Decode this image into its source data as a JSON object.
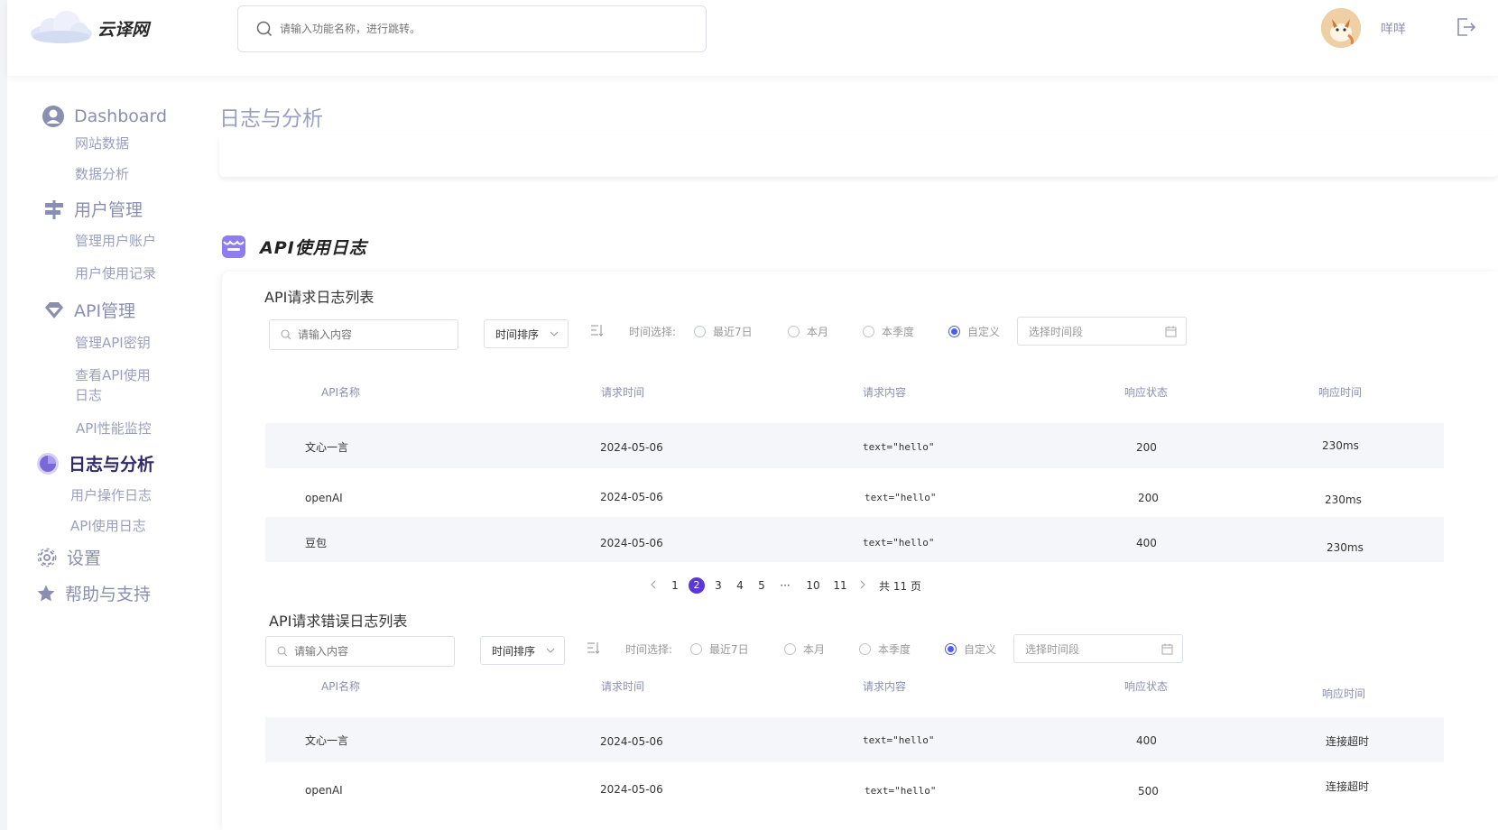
{
  "header": {
    "logo_text": "云译网",
    "search_placeholder": "请输入功能名称，进行跳转。",
    "username": "咩咩"
  },
  "sidebar": {
    "groups": [
      {
        "label": "Dashboard",
        "icon": "user-circle-icon",
        "items": [
          "网站数据",
          "数据分析"
        ]
      },
      {
        "label": "用户管理",
        "icon": "signpost-icon",
        "items": [
          "管理用户账户",
          "用户使用记录"
        ]
      },
      {
        "label": "API管理",
        "icon": "diamond-icon",
        "items": [
          "管理API密钥",
          "查看API使用日志",
          "API性能监控"
        ]
      },
      {
        "label": "日志与分析",
        "icon": "pie-chart-icon",
        "items": [
          "用户操作日志",
          "API使用日志"
        ],
        "active": true
      },
      {
        "label": "设置",
        "icon": "gear-icon",
        "items": []
      },
      {
        "label": "帮助与支持",
        "icon": "star-icon",
        "items": []
      }
    ],
    "api_log_item_line1": "查看API使用",
    "api_log_item_line2": "日志"
  },
  "page": {
    "title": "日志与分析",
    "section_title": "API使用日志"
  },
  "request_log": {
    "title": "API请求日志列表",
    "search_placeholder": "请输入内容",
    "sort_label": "时间排序",
    "time_label": "时间选择:",
    "options": [
      "最近7日",
      "本月",
      "本季度",
      "自定义"
    ],
    "selected_option": "自定义",
    "range_placeholder": "选择时间段",
    "columns": [
      "API名称",
      "请求时间",
      "请求内容",
      "响应状态",
      "响应时间"
    ],
    "rows": [
      [
        "文心一言",
        "2024-05-06",
        "text=\"hello\"",
        "200",
        "230ms"
      ],
      [
        "openAI",
        "2024-05-06",
        "text=\"hello\"",
        "200",
        "230ms"
      ],
      [
        "豆包",
        "2024-05-06",
        "text=\"hello\"",
        "400",
        "230ms"
      ]
    ],
    "pagination": {
      "pages": [
        "1",
        "2",
        "3",
        "4",
        "5",
        "···",
        "10",
        "11"
      ],
      "current": "2",
      "total_text": "共 11 页"
    }
  },
  "error_log": {
    "title": "API请求错误日志列表",
    "search_placeholder": "请输入内容",
    "sort_label": "时间排序",
    "time_label": "时间选择:",
    "options": [
      "最近7日",
      "本月",
      "本季度",
      "自定义"
    ],
    "selected_option": "自定义",
    "range_placeholder": "选择时间段",
    "columns": [
      "API名称",
      "请求时间",
      "请求内容",
      "响应状态",
      "响应时间"
    ],
    "rows": [
      [
        "文心一言",
        "2024-05-06",
        "text=\"hello\"",
        "400",
        "连接超时"
      ],
      [
        "openAI",
        "2024-05-06",
        "text=\"hello\"",
        "500",
        "连接超时"
      ]
    ]
  },
  "colors": {
    "accent": "#5a37d6",
    "radio_checked": "#4e5bf0",
    "nav_text": "#8a8fb2",
    "nav_active": "#2f2a67",
    "row_stripe": "#f5f6f9"
  }
}
